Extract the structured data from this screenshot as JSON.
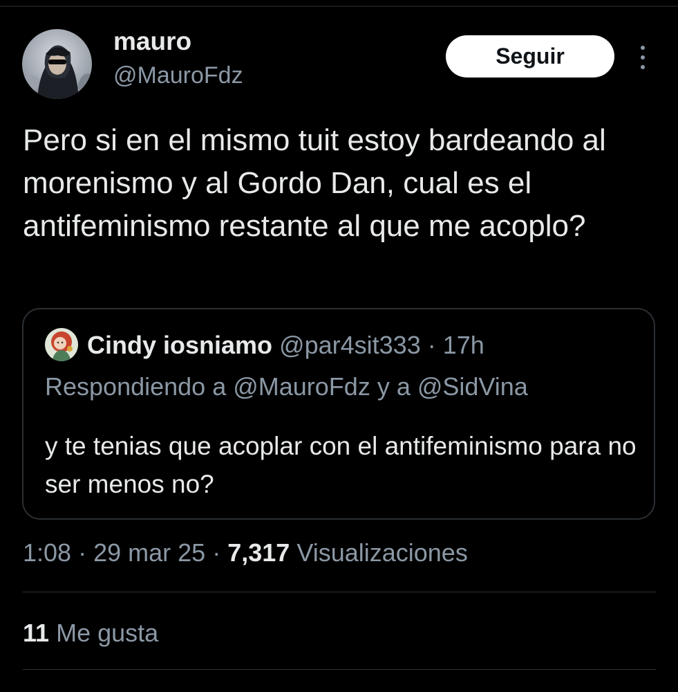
{
  "author": {
    "display_name": "mauro",
    "handle": "@MauroFdz",
    "avatar_icon": "user-avatar-hooded-figure"
  },
  "follow_button": {
    "label": "Seguir"
  },
  "more_button": {
    "icon": "more-vertical-icon"
  },
  "tweet": {
    "text": "Pero si en el mismo tuit estoy bardeando al morenismo y al Gordo Dan, cual es el antifeminismo restante al que me acoplo?"
  },
  "quoted_tweet": {
    "display_name": "Cindy iosniamo",
    "handle": "@par4sit333",
    "separator": "·",
    "time": "17h",
    "replying_to": "Respondiendo a @MauroFdz y a @SidVina",
    "text": "y te tenias que acoplar con el antifeminismo para no ser menos no?",
    "avatar_icon": "user-avatar-illustration"
  },
  "meta": {
    "time": "1:08",
    "separator": "·",
    "date": "29 mar 25",
    "views_count": "7,317",
    "views_label": "Visualizaciones"
  },
  "engagement": {
    "likes_count": "11",
    "likes_label": "Me gusta"
  },
  "colors": {
    "background": "#000000",
    "text_primary": "#e7e9ea",
    "text_secondary": "#8b98a5",
    "border": "#2f3336",
    "button_bg": "#ffffff"
  }
}
